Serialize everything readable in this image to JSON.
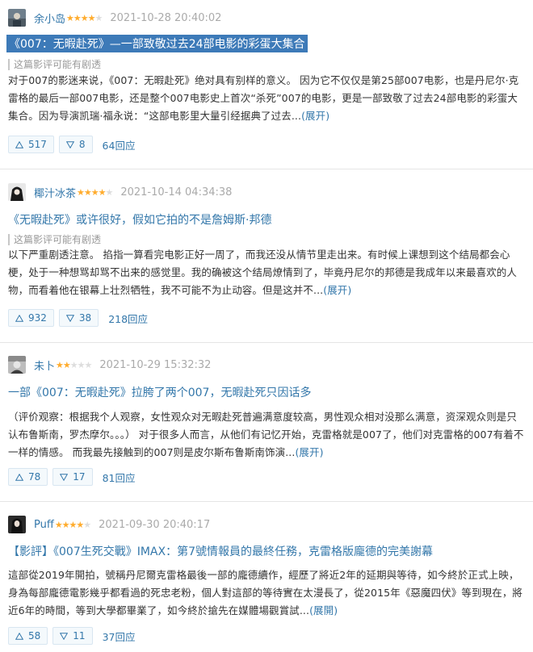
{
  "reviews": [
    {
      "user": "余小岛",
      "rating": 4,
      "date": "2021-10-28 20:40:02",
      "title": "《007：无暇赴死》—一部致敬过去24部电影的彩蛋大集合",
      "spoiler": "这篇影评可能有剧透",
      "body": "对于007的影迷来说，《007：无暇赴死》绝对具有别样的意义。 因为它不仅仅是第25部007电影，也是丹尼尔·克雷格的最后一部007电影，还是整个007电影史上首次“杀死”007的电影，更是一部致敬了过去24部电影的彩蛋大集合。因为导演凯瑞·福永说：“这部电影里大量引经据典了过去...",
      "expand": "(展开)",
      "up": "517",
      "down": "8",
      "replies": "64回应"
    },
    {
      "user": "椰汁冰茶",
      "rating": 4,
      "date": "2021-10-14 04:34:38",
      "title": "《无暇赴死》或许很好，假如它拍的不是詹姆斯·邦德",
      "spoiler": "这篇影评可能有剧透",
      "body": "以下严重剧透注意。 掐指一算看完电影正好一周了，而我还没从情节里走出来。有时候上课想到这个结局都会心梗，处于一种想骂却骂不出来的感觉里。我的确被这个结局燎情到了，毕竟丹尼尔的邦德是我成年以来最喜欢的人物，而看着他在银幕上壮烈牺牲，我不可能不为止动容。但是这并不...",
      "expand": "(展开)",
      "up": "932",
      "down": "38",
      "replies": "218回应"
    },
    {
      "user": "未卜",
      "rating": 2,
      "date": "2021-10-29 15:32:32",
      "title": "一部《007：无暇赴死》拉胯了两个007，无暇赴死只因话多",
      "spoiler": "",
      "body": "（评价观察：根据我个人观察，女性观众对无暇赴死普遍满意度较高，男性观众相对没那么满意，资深观众则是只认布鲁斯南，罗杰摩尔。。。） 对于很多人而言，从他们有记忆开始，克雷格就是007了，他们对克雷格的007有着不一样的情感。 而我最先接触到的007则是皮尔斯布鲁斯南饰演...",
      "expand": "(展开)",
      "up": "78",
      "down": "17",
      "replies": "81回应"
    },
    {
      "user": "Puff",
      "rating": 4,
      "date": "2021-09-30 20:40:17",
      "title": "【影評】《007生死交戰》IMAX：第7號情報員的最終任務，克雷格版龐德的完美謝幕",
      "spoiler": "",
      "body": "這部從2019年開拍，號稱丹尼爾克雷格最後一部的龐德續作，經歷了將近2年的延期與等待，如今終於正式上映，身為每部龐德電影幾乎都看過的死忠老粉，個人對這部的等待實在太漫長了，從2015年《惡魔四伏》等到現在，將近6年的時間，等到大學都畢業了，如今終於搶先在媒體場觀賞試...",
      "expand": "(展開)",
      "up": "58",
      "down": "11",
      "replies": "37回应"
    }
  ],
  "colors": {
    "link": "#3377aa",
    "star_on": "#ffac2d",
    "star_off": "#dddddd",
    "highlight": "#3d7ab8",
    "vote_bg": "#f4f9fc"
  }
}
